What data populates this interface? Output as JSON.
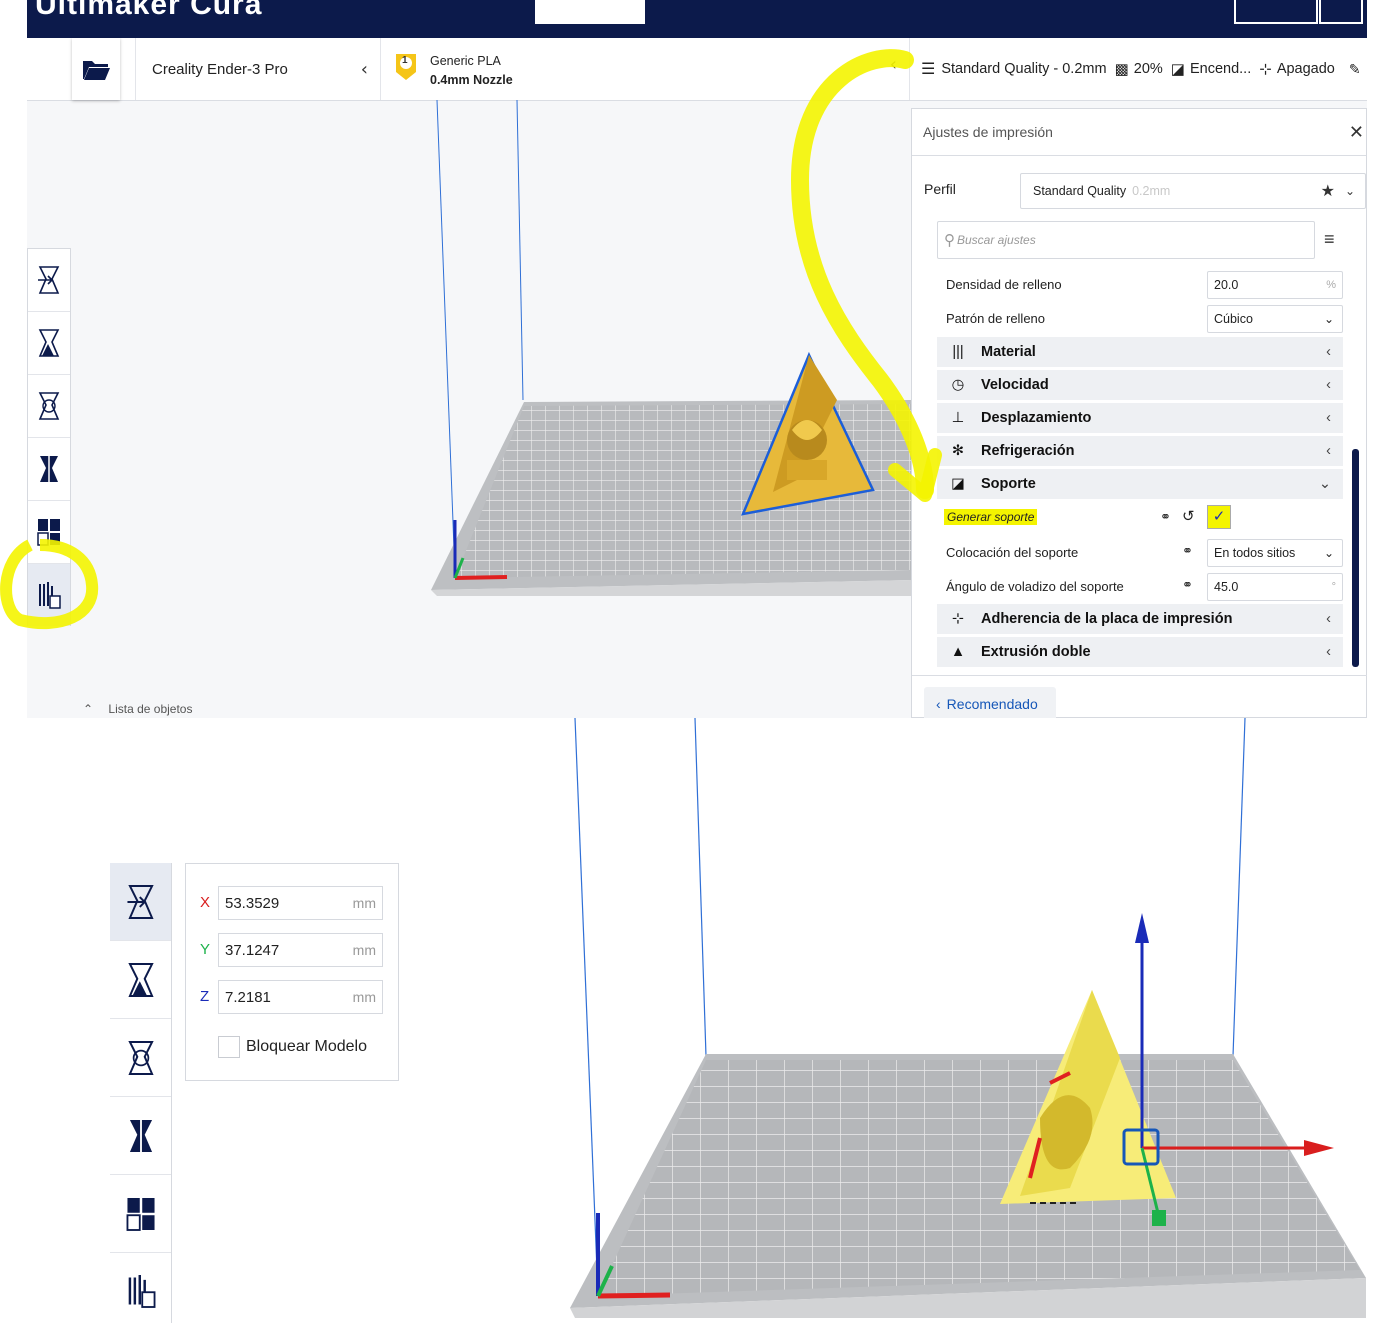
{
  "app": {
    "title": "Ultimaker Cura"
  },
  "toolbar": {
    "printer": "Creality Ender-3 Pro",
    "material_badge": "1",
    "material_name": "Generic PLA",
    "nozzle": "0.4mm Nozzle",
    "quality": "Standard Quality - 0.2mm",
    "infill": "20%",
    "support": "Encend...",
    "adhesion": "Apagado"
  },
  "print_settings": {
    "title": "Ajustes de impresión",
    "profile_label": "Perfil",
    "profile_value": "Standard Quality",
    "profile_suffix": "0.2mm",
    "search_placeholder": "Buscar ajustes",
    "infill_density_label": "Densidad de relleno",
    "infill_density_value": "20.0",
    "infill_density_unit": "%",
    "infill_pattern_label": "Patrón de relleno",
    "infill_pattern_value": "Cúbico",
    "categories": {
      "material": "Material",
      "speed": "Velocidad",
      "travel": "Desplazamiento",
      "cooling": "Refrigeración",
      "support": "Soporte",
      "adhesion": "Adherencia de la placa de impresión",
      "dual": "Extrusión doble"
    },
    "generate_support_label": "Generar soporte",
    "support_placement_label": "Colocación del soporte",
    "support_placement_value": "En todos sitios",
    "support_angle_label": "Ángulo de voladizo del soporte",
    "support_angle_value": "45.0",
    "support_angle_unit": "°",
    "recommended_button": "Recomendado"
  },
  "object_list": {
    "label": "Lista de objetos"
  },
  "move_tool": {
    "x_label": "X",
    "x_value": "53.3529",
    "y_label": "Y",
    "y_value": "37.1247",
    "z_label": "Z",
    "z_value": "7.2181",
    "unit": "mm",
    "lock_label": "Bloquear Modelo"
  },
  "colors": {
    "navbar": "#0c1a4b",
    "highlight": "#f4f400",
    "model_yellow": "#f2cf3c",
    "axis_x": "#d91e1e",
    "axis_y": "#1db24a",
    "axis_z": "#1a2bb8",
    "accent_blue": "#1657b8"
  }
}
